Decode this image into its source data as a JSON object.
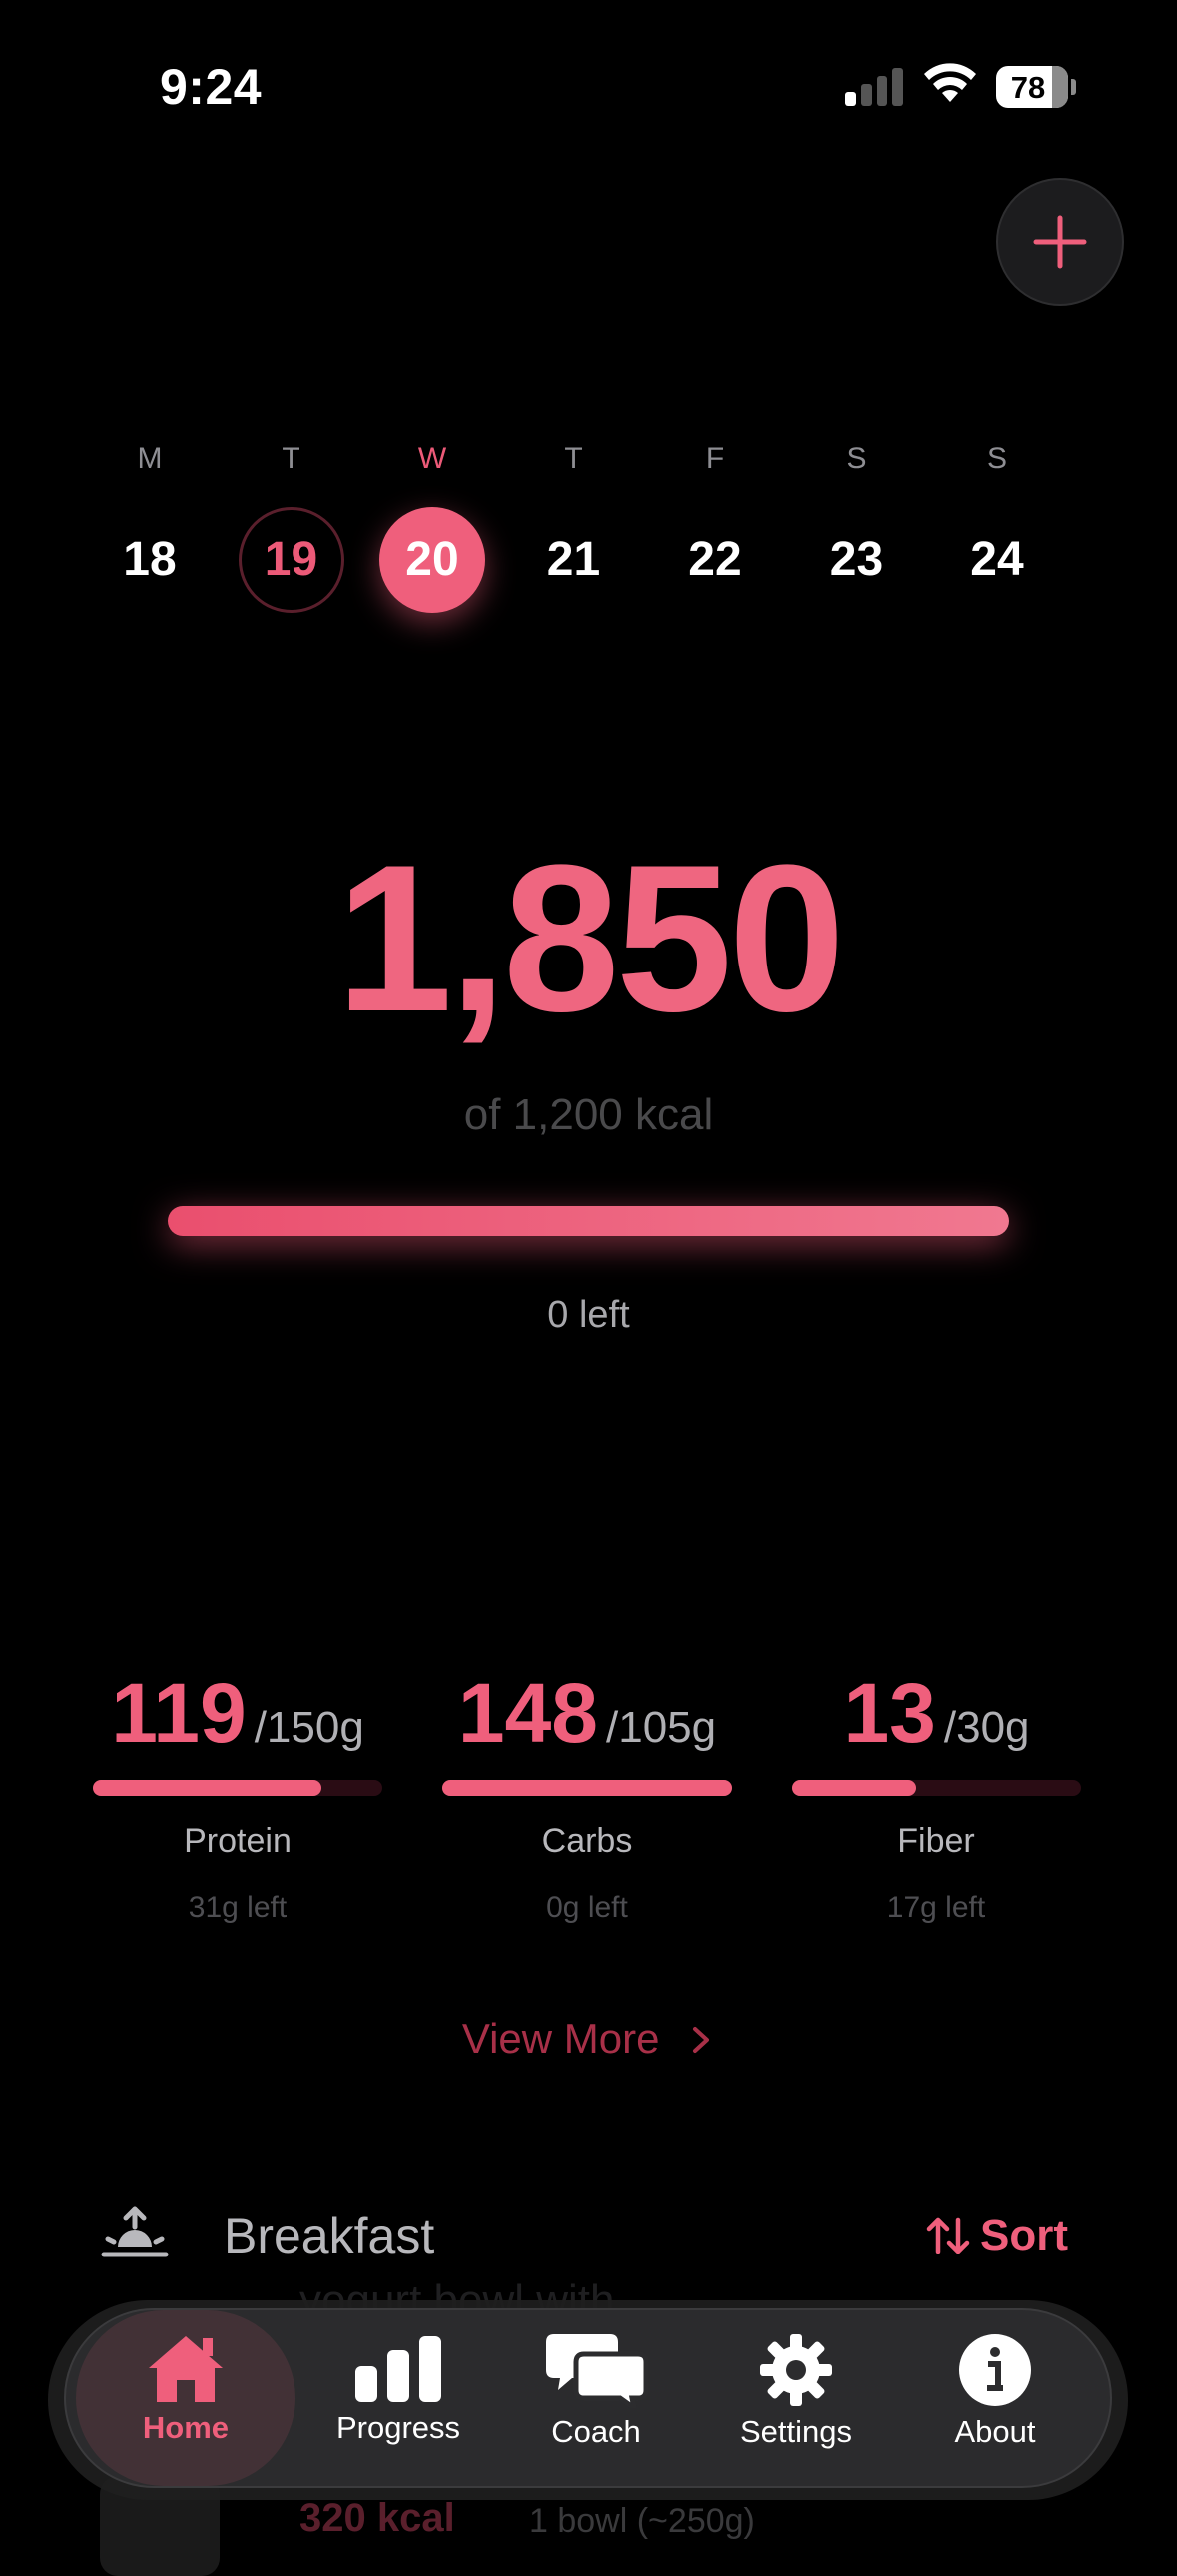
{
  "status_bar": {
    "time": "9:24",
    "battery": "78"
  },
  "week": {
    "days": [
      {
        "letter": "M",
        "num": "18"
      },
      {
        "letter": "T",
        "num": "19"
      },
      {
        "letter": "W",
        "num": "20"
      },
      {
        "letter": "T",
        "num": "21"
      },
      {
        "letter": "F",
        "num": "22"
      },
      {
        "letter": "S",
        "num": "23"
      },
      {
        "letter": "S",
        "num": "24"
      }
    ],
    "today_index": 1,
    "selected_index": 2
  },
  "calories": {
    "value": "1,850",
    "goal_text": "of 1,200 kcal",
    "remaining_text": "0 left",
    "progress": 1.0
  },
  "macros": [
    {
      "value": "119",
      "target": "/150g",
      "name": "Protein",
      "left": "31g left",
      "progress": 0.79
    },
    {
      "value": "148",
      "target": "/105g",
      "name": "Carbs",
      "left": "0g left",
      "progress": 1.0
    },
    {
      "value": "13",
      "target": "/30g",
      "name": "Fiber",
      "left": "17g left",
      "progress": 0.43
    }
  ],
  "view_more_label": "View More",
  "meal_section": {
    "title": "Breakfast",
    "sort_label": "Sort",
    "item": {
      "name": "yogurt bowl with",
      "kcal": "320 kcal",
      "quantity": "1 bowl (~250g)"
    }
  },
  "nav": {
    "items": [
      {
        "label": "Home",
        "icon": "home-icon"
      },
      {
        "label": "Progress",
        "icon": "bar-chart-icon"
      },
      {
        "label": "Coach",
        "icon": "chat-bubbles-icon"
      },
      {
        "label": "Settings",
        "icon": "gear-icon"
      },
      {
        "label": "About",
        "icon": "info-icon"
      }
    ],
    "active_index": 0
  },
  "colors": {
    "accent": "#ef5f7c",
    "background": "#000000"
  }
}
